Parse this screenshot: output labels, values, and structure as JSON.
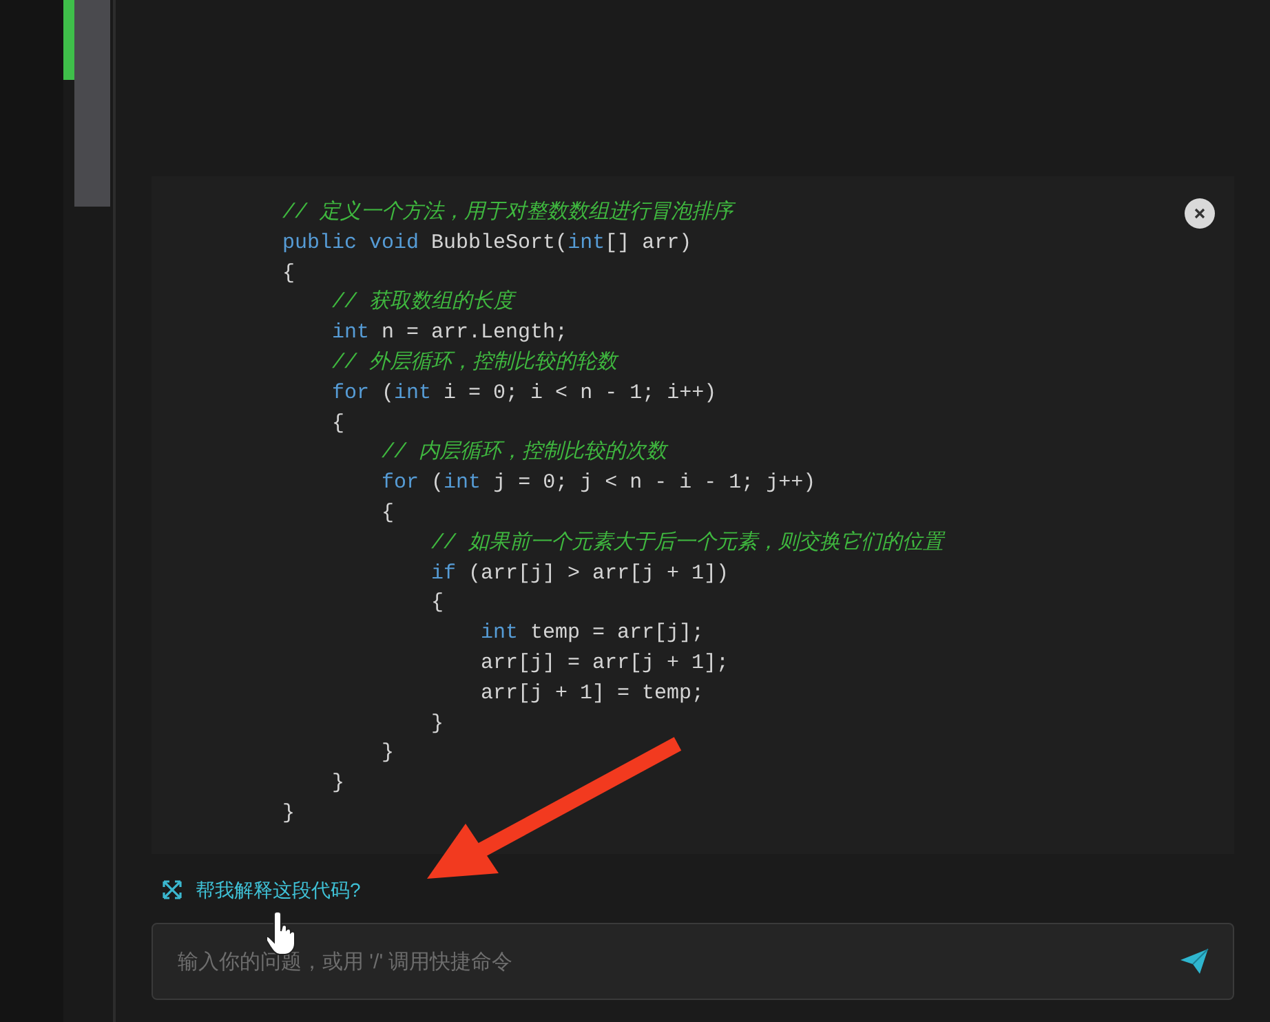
{
  "code_block": {
    "lines": [
      [
        {
          "kind": "comment",
          "text": "// 定义一个方法，用于对整数数组进行冒泡排序"
        }
      ],
      [
        {
          "kind": "keyword",
          "text": "public void"
        },
        {
          "kind": "plain",
          "text": " BubbleSort("
        },
        {
          "kind": "keyword",
          "text": "int"
        },
        {
          "kind": "plain",
          "text": "[] arr)"
        }
      ],
      [
        {
          "kind": "plain",
          "text": "{"
        }
      ],
      [
        {
          "kind": "comment",
          "text": "    // 获取数组的长度"
        }
      ],
      [
        {
          "kind": "keyword",
          "text": "    int"
        },
        {
          "kind": "plain",
          "text": " n = arr.Length;"
        }
      ],
      [
        {
          "kind": "comment",
          "text": "    // 外层循环，控制比较的轮数"
        }
      ],
      [
        {
          "kind": "keyword",
          "text": "    for"
        },
        {
          "kind": "plain",
          "text": " ("
        },
        {
          "kind": "keyword",
          "text": "int"
        },
        {
          "kind": "plain",
          "text": " i = 0; i < n - 1; i++)"
        }
      ],
      [
        {
          "kind": "plain",
          "text": "    {"
        }
      ],
      [
        {
          "kind": "comment",
          "text": "        // 内层循环，控制比较的次数"
        }
      ],
      [
        {
          "kind": "keyword",
          "text": "        for"
        },
        {
          "kind": "plain",
          "text": " ("
        },
        {
          "kind": "keyword",
          "text": "int"
        },
        {
          "kind": "plain",
          "text": " j = 0; j < n - i - 1; j++)"
        }
      ],
      [
        {
          "kind": "plain",
          "text": "        {"
        }
      ],
      [
        {
          "kind": "comment",
          "text": "            // 如果前一个元素大于后一个元素，则交换它们的位置"
        }
      ],
      [
        {
          "kind": "keyword",
          "text": "            if"
        },
        {
          "kind": "plain",
          "text": " (arr[j] > arr[j + 1])"
        }
      ],
      [
        {
          "kind": "plain",
          "text": "            {"
        }
      ],
      [
        {
          "kind": "keyword",
          "text": "                int"
        },
        {
          "kind": "plain",
          "text": " temp = arr[j];"
        }
      ],
      [
        {
          "kind": "plain",
          "text": "                arr[j] = arr[j + 1];"
        }
      ],
      [
        {
          "kind": "plain",
          "text": "                arr[j + 1] = temp;"
        }
      ],
      [
        {
          "kind": "plain",
          "text": "            }"
        }
      ],
      [
        {
          "kind": "plain",
          "text": "        }"
        }
      ],
      [
        {
          "kind": "plain",
          "text": "    }"
        }
      ],
      [
        {
          "kind": "plain",
          "text": "}"
        }
      ]
    ]
  },
  "suggestion": {
    "label": "帮我解释这段代码?"
  },
  "chat_input": {
    "placeholder": "输入你的问题，或用 '/' 调用快捷命令"
  }
}
